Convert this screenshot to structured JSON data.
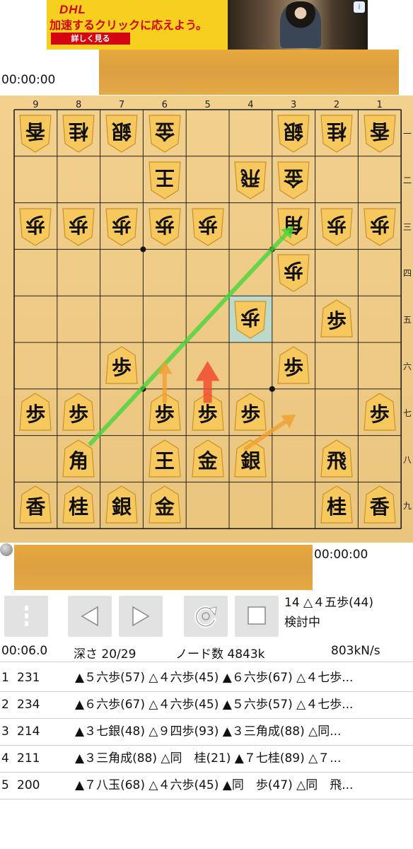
{
  "ad": {
    "logo": "DHL",
    "headline": "加速するクリックに応えよう。",
    "button": "詳しく見る",
    "info_icon": "info-icon"
  },
  "gote_timer": "00:00:00",
  "sente_timer": "00:00:00",
  "board": {
    "files": [
      "9",
      "8",
      "7",
      "6",
      "5",
      "4",
      "3",
      "2",
      "1"
    ],
    "ranks": [
      "一",
      "二",
      "三",
      "四",
      "五",
      "六",
      "七",
      "八",
      "九"
    ],
    "highlight_square": "4五",
    "pieces": [
      {
        "sq": "9一",
        "k": "香",
        "gote": true
      },
      {
        "sq": "8一",
        "k": "桂",
        "gote": true
      },
      {
        "sq": "7一",
        "k": "銀",
        "gote": true
      },
      {
        "sq": "6一",
        "k": "金",
        "gote": true
      },
      {
        "sq": "3一",
        "k": "銀",
        "gote": true
      },
      {
        "sq": "2一",
        "k": "桂",
        "gote": true
      },
      {
        "sq": "1一",
        "k": "香",
        "gote": true
      },
      {
        "sq": "6二",
        "k": "王",
        "gote": true
      },
      {
        "sq": "4二",
        "k": "飛",
        "gote": true
      },
      {
        "sq": "3二",
        "k": "金",
        "gote": true
      },
      {
        "sq": "9三",
        "k": "歩",
        "gote": true
      },
      {
        "sq": "8三",
        "k": "歩",
        "gote": true
      },
      {
        "sq": "7三",
        "k": "歩",
        "gote": true
      },
      {
        "sq": "6三",
        "k": "歩",
        "gote": true
      },
      {
        "sq": "5三",
        "k": "歩",
        "gote": true
      },
      {
        "sq": "3三",
        "k": "角",
        "gote": true
      },
      {
        "sq": "2三",
        "k": "歩",
        "gote": true
      },
      {
        "sq": "1三",
        "k": "歩",
        "gote": true
      },
      {
        "sq": "3四",
        "k": "歩",
        "gote": true
      },
      {
        "sq": "4五",
        "k": "歩",
        "gote": true
      },
      {
        "sq": "2五",
        "k": "歩",
        "gote": false
      },
      {
        "sq": "7六",
        "k": "歩",
        "gote": false
      },
      {
        "sq": "3六",
        "k": "歩",
        "gote": false
      },
      {
        "sq": "9七",
        "k": "歩",
        "gote": false
      },
      {
        "sq": "8七",
        "k": "歩",
        "gote": false
      },
      {
        "sq": "6七",
        "k": "歩",
        "gote": false
      },
      {
        "sq": "5七",
        "k": "歩",
        "gote": false
      },
      {
        "sq": "4七",
        "k": "歩",
        "gote": false
      },
      {
        "sq": "1七",
        "k": "歩",
        "gote": false
      },
      {
        "sq": "8八",
        "k": "角",
        "gote": false
      },
      {
        "sq": "6八",
        "k": "王",
        "gote": false
      },
      {
        "sq": "5八",
        "k": "金",
        "gote": false
      },
      {
        "sq": "4八",
        "k": "銀",
        "gote": false
      },
      {
        "sq": "2八",
        "k": "飛",
        "gote": false
      },
      {
        "sq": "9九",
        "k": "香",
        "gote": false
      },
      {
        "sq": "8九",
        "k": "桂",
        "gote": false
      },
      {
        "sq": "7九",
        "k": "銀",
        "gote": false
      },
      {
        "sq": "6九",
        "k": "金",
        "gote": false
      },
      {
        "sq": "2九",
        "k": "桂",
        "gote": false
      },
      {
        "sq": "1九",
        "k": "香",
        "gote": false
      }
    ],
    "hint_arrows": [
      {
        "from": "8八",
        "to": "3三",
        "color": "#45d63a",
        "kind": "best"
      },
      {
        "from": "6七",
        "to": "6六",
        "color": "#f0a030",
        "kind": "candidate"
      },
      {
        "from": "5七",
        "to": "5六",
        "color": "#f04a2a",
        "kind": "candidate"
      },
      {
        "from": "4八",
        "to": "3七",
        "color": "#f0a030",
        "kind": "candidate"
      }
    ]
  },
  "toolbar": {
    "menu_icon": "menu-icon",
    "back_icon": "back-triangle-icon",
    "forward_icon": "forward-triangle-icon",
    "analyze_icon": "analysis-refresh-icon",
    "stop_icon": "stop-square-icon"
  },
  "move_info": {
    "last_move": "14 △４五歩(44)",
    "status": "検討中"
  },
  "stats": {
    "time": "00:06.0",
    "depth": "深さ  20/29",
    "nodes": "ノード数  4843k",
    "nps": "803kN/s"
  },
  "pv": [
    {
      "rank": "1",
      "score": "231",
      "line": "▲５六歩(57) △４六歩(45) ▲６六歩(67) △４七歩..."
    },
    {
      "rank": "2",
      "score": "234",
      "line": "▲６六歩(67) △４六歩(45) ▲５六歩(57) △４七歩..."
    },
    {
      "rank": "3",
      "score": "214",
      "line": "▲３七銀(48) △９四歩(93) ▲３三角成(88) △同..."
    },
    {
      "rank": "4",
      "score": "211",
      "line": "▲３三角成(88) △同　桂(21) ▲７七桂(89) △７..."
    },
    {
      "rank": "5",
      "score": "200",
      "line": "▲７八玉(68) △４六歩(45) ▲同　歩(47) △同　飛..."
    }
  ]
}
